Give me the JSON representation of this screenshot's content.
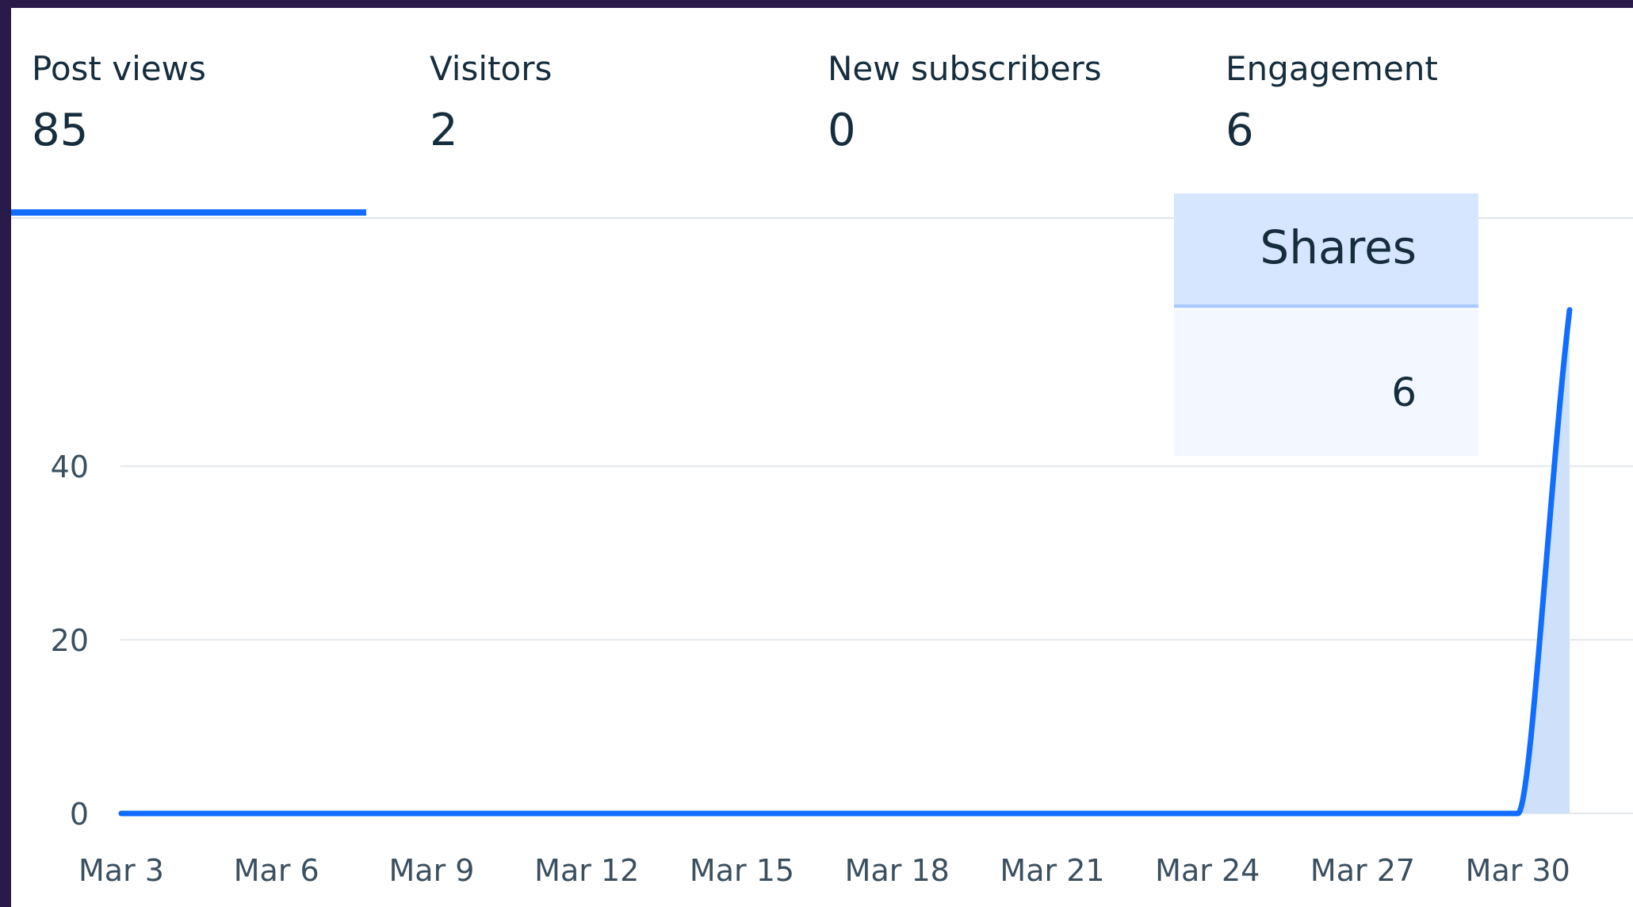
{
  "metric_tabs": [
    {
      "label": "Post views",
      "value": "85",
      "selected": true
    },
    {
      "label": "Visitors",
      "value": "2",
      "selected": false
    },
    {
      "label": "New subscribers",
      "value": "0",
      "selected": false
    },
    {
      "label": "Engagement",
      "value": "6",
      "selected": false
    }
  ],
  "tooltip": {
    "title": "Shares",
    "value": "6"
  },
  "colors": {
    "accent": "#116dff",
    "area_fill": "#cfe1fa",
    "text": "#162d3d",
    "axis_text": "#3b4f5f",
    "gridline": "#e4e8ec",
    "background": "#2a1a4a"
  },
  "chart_data": {
    "type": "area",
    "x": [
      "Mar 3",
      "Mar 4",
      "Mar 5",
      "Mar 6",
      "Mar 7",
      "Mar 8",
      "Mar 9",
      "Mar 10",
      "Mar 11",
      "Mar 12",
      "Mar 13",
      "Mar 14",
      "Mar 15",
      "Mar 16",
      "Mar 17",
      "Mar 18",
      "Mar 19",
      "Mar 20",
      "Mar 21",
      "Mar 22",
      "Mar 23",
      "Mar 24",
      "Mar 25",
      "Mar 26",
      "Mar 27",
      "Mar 28",
      "Mar 29",
      "Mar 30",
      "Mar 31"
    ],
    "x_tick_labels": [
      "Mar 3",
      "Mar 6",
      "Mar 9",
      "Mar 12",
      "Mar 15",
      "Mar 18",
      "Mar 21",
      "Mar 24",
      "Mar 27",
      "Mar 30"
    ],
    "series": [
      {
        "values": [
          0,
          0,
          0,
          0,
          0,
          0,
          0,
          0,
          0,
          0,
          0,
          0,
          0,
          0,
          0,
          0,
          0,
          0,
          0,
          0,
          0,
          0,
          0,
          0,
          0,
          0,
          0,
          0,
          58
        ]
      }
    ],
    "y_ticks": [
      0,
      20,
      40
    ],
    "ylim": [
      0,
      70
    ],
    "grid": true,
    "xlabel": "",
    "ylabel": ""
  }
}
